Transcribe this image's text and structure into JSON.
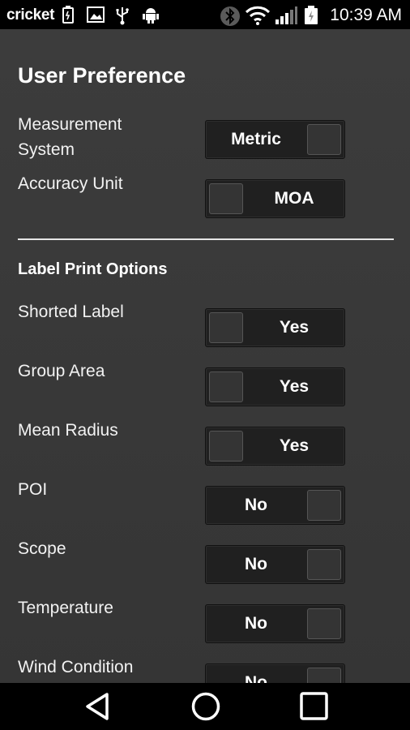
{
  "status_bar": {
    "carrier": "cricket",
    "time": "10:39 AM",
    "icons": [
      "battery-saver-icon",
      "image-icon",
      "usb-icon",
      "android-debug-icon",
      "bluetooth-icon",
      "wifi-icon",
      "signal-icon",
      "battery-charging-icon"
    ]
  },
  "user_preference": {
    "title": "User Preference",
    "measurement_system": {
      "label": "Measurement System",
      "value": "Metric",
      "state": "on"
    },
    "accuracy_unit": {
      "label": "Accuracy Unit",
      "value": "MOA",
      "state": "off"
    }
  },
  "label_print_options": {
    "title": "Label Print Options",
    "items": [
      {
        "label": "Shorted Label",
        "value": "Yes",
        "state": "off"
      },
      {
        "label": "Group Area",
        "value": "Yes",
        "state": "off"
      },
      {
        "label": "Mean Radius",
        "value": "Yes",
        "state": "off"
      },
      {
        "label": "POI",
        "value": "No",
        "state": "on"
      },
      {
        "label": "Scope",
        "value": "No",
        "state": "on"
      },
      {
        "label": "Temperature",
        "value": "No",
        "state": "on"
      },
      {
        "label": "Wind Condition",
        "value": "No",
        "state": "on"
      }
    ]
  },
  "nav_bar": {
    "buttons": [
      "back-icon",
      "home-icon",
      "recents-icon"
    ]
  },
  "colors": {
    "background": "#3a3a3a",
    "toggle_track": "#202020",
    "toggle_knob": "#343434",
    "divider": "#e6e6e6"
  }
}
